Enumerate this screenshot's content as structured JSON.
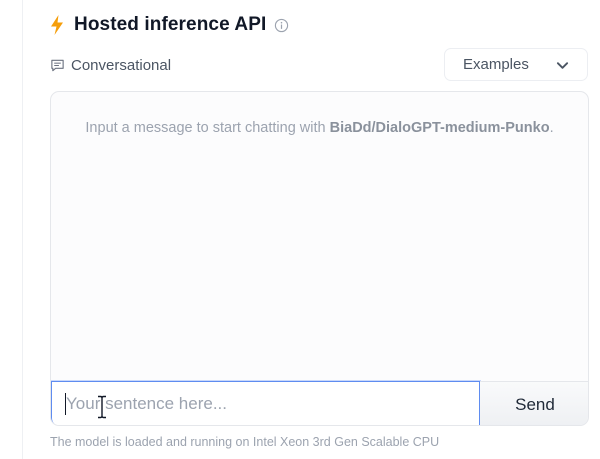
{
  "header": {
    "title": "Hosted inference API",
    "icons": {
      "leading": "bolt-icon",
      "trailing": "info-icon"
    },
    "accent_color": "#f59e0b"
  },
  "task": {
    "label": "Conversational",
    "icon": "chat-icon"
  },
  "examples": {
    "label": "Examples",
    "icon": "chevron-down-icon"
  },
  "chat": {
    "prompt_prefix": "Input a message to start chatting with ",
    "model_name": "BiaDd/DialoGPT-medium-Punko",
    "prompt_suffix": "."
  },
  "input": {
    "placeholder": "Your sentence here...",
    "value": "",
    "focus_color": "#5f8cf0"
  },
  "send": {
    "label": "Send"
  },
  "footer": {
    "note": "The model is loaded and running on Intel Xeon 3rd Gen Scalable CPU"
  }
}
